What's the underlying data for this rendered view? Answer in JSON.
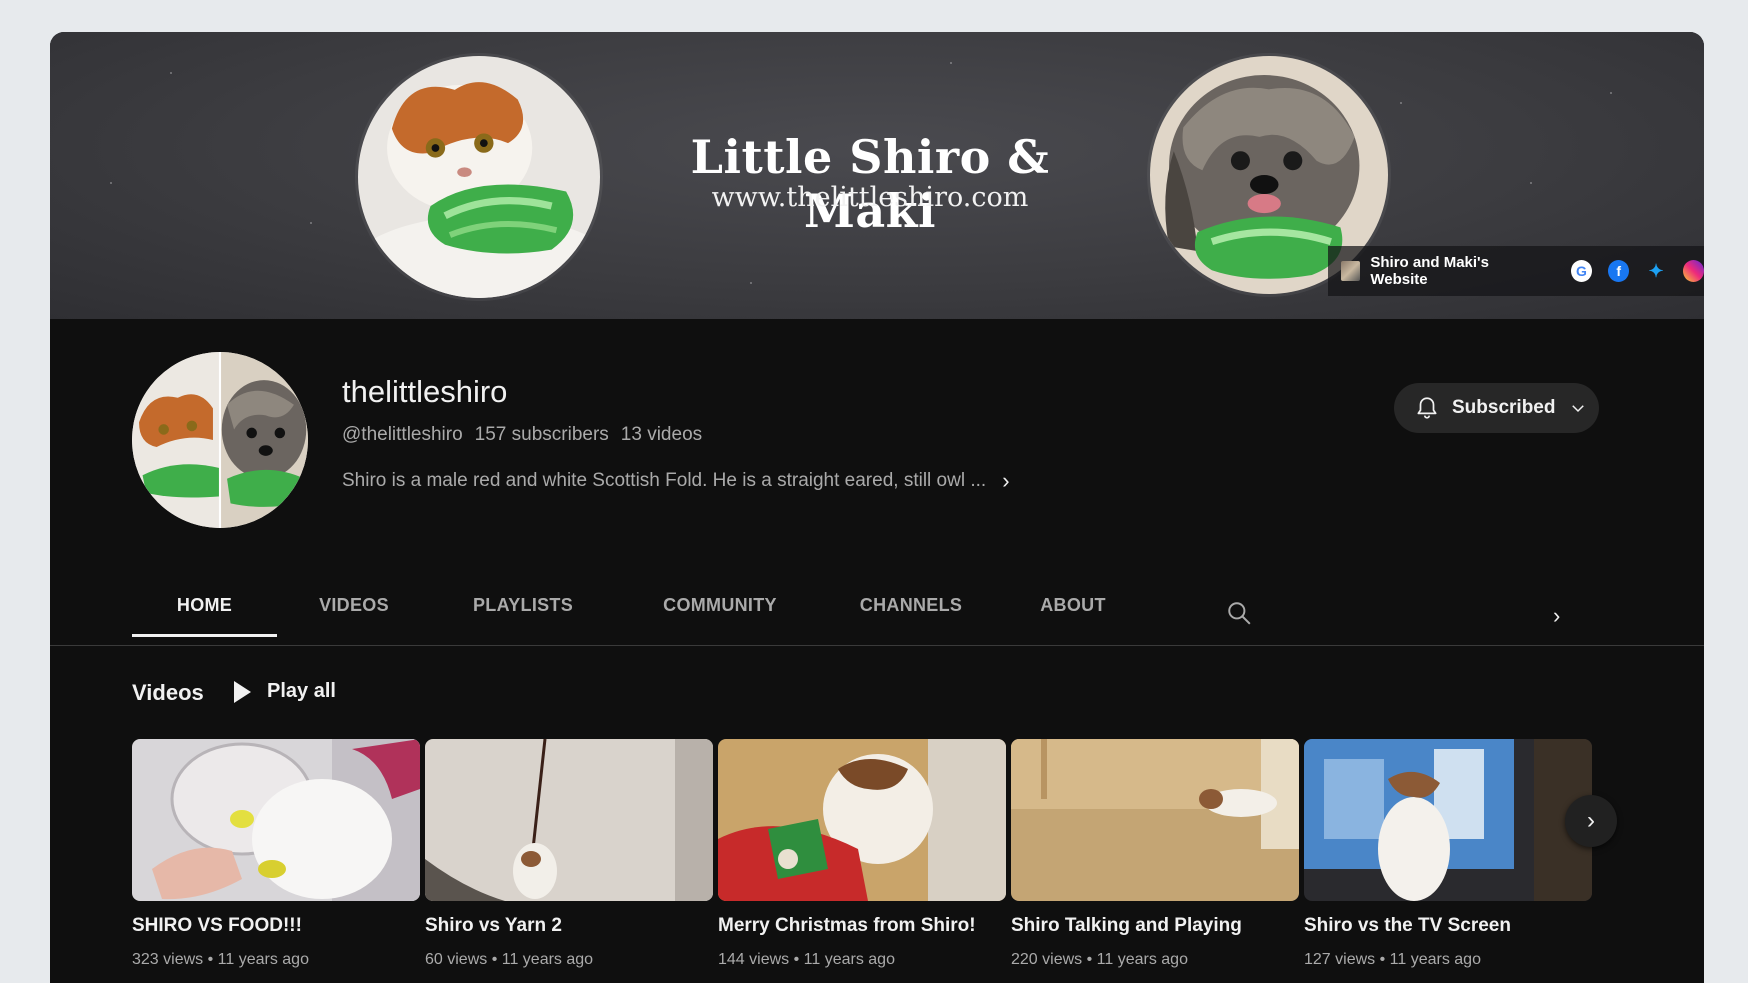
{
  "banner": {
    "title": "Little Shiro & Maki",
    "url": "www.thelittleshiro.com",
    "link_label": "Shiro and Maki's Website",
    "social_icons": [
      "google-icon",
      "facebook-icon",
      "twitter-icon",
      "instagram-icon"
    ]
  },
  "channel": {
    "name": "thelittleshiro",
    "handle": "@thelittleshiro",
    "subscribers": "157 subscribers",
    "videos_count": "13 videos",
    "description": "Shiro is a male red and white Scottish Fold. He is a straight eared, still owl ...",
    "subscribe_label": "Subscribed"
  },
  "tabs": [
    {
      "label": "HOME",
      "active": true
    },
    {
      "label": "VIDEOS",
      "active": false
    },
    {
      "label": "PLAYLISTS",
      "active": false
    },
    {
      "label": "COMMUNITY",
      "active": false
    },
    {
      "label": "CHANNELS",
      "active": false
    },
    {
      "label": "ABOUT",
      "active": false
    }
  ],
  "section": {
    "title": "Videos",
    "play_all": "Play all"
  },
  "videos": [
    {
      "title": "SHIRO VS FOOD!!!",
      "views": "323 views",
      "age": "11 years ago"
    },
    {
      "title": "Shiro vs Yarn 2",
      "views": "60 views",
      "age": "11 years ago"
    },
    {
      "title": "Merry Christmas from Shiro!",
      "views": "144 views",
      "age": "11 years ago"
    },
    {
      "title": "Shiro Talking and Playing",
      "views": "220 views",
      "age": "11 years ago"
    },
    {
      "title": "Shiro vs the TV Screen",
      "views": "127 views",
      "age": "11 years ago"
    }
  ],
  "colors": {
    "background": "#0f0f0f",
    "text_primary": "#f1f1f1",
    "text_secondary": "#aaaaaa",
    "button_bg": "#272727"
  }
}
